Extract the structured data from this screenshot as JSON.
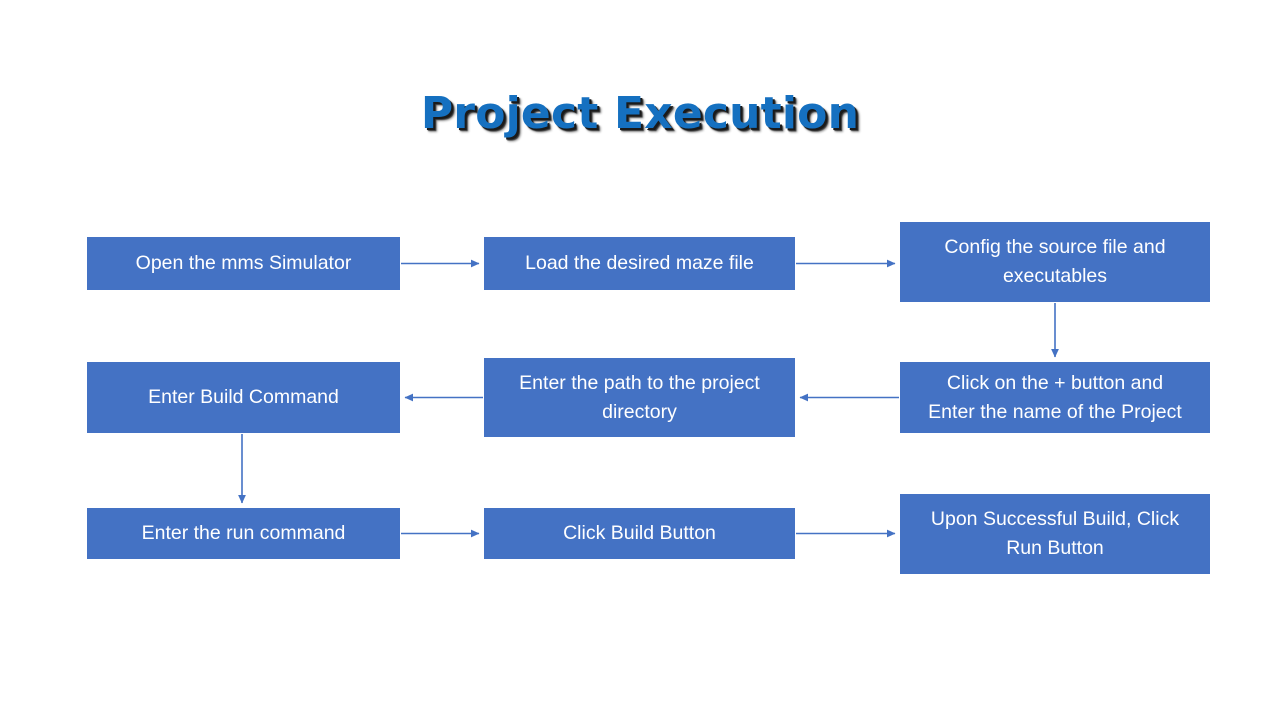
{
  "title": "Project Execution",
  "colors": {
    "box_fill": "#4472C4",
    "box_text": "#FFFFFF",
    "title_text": "#1570C0",
    "title_shadow": "#1A1A1A",
    "connector": "#4472C4",
    "background": "#FFFFFF"
  },
  "flow": {
    "nodes": [
      {
        "id": "n1",
        "label": "Open the mms Simulator",
        "row": 1,
        "col": 1
      },
      {
        "id": "n2",
        "label": "Load the desired maze file",
        "row": 1,
        "col": 2
      },
      {
        "id": "n3",
        "label": "Config the source file and\nexecutables",
        "row": 1,
        "col": 3
      },
      {
        "id": "n4",
        "label": "Click on the + button and\nEnter the name of the Project",
        "row": 2,
        "col": 3
      },
      {
        "id": "n5",
        "label": "Enter the path to the project\ndirectory",
        "row": 2,
        "col": 2
      },
      {
        "id": "n6",
        "label": "Enter Build Command",
        "row": 2,
        "col": 1
      },
      {
        "id": "n7",
        "label": "Enter the run command",
        "row": 3,
        "col": 1
      },
      {
        "id": "n8",
        "label": "Click Build Button",
        "row": 3,
        "col": 2
      },
      {
        "id": "n9",
        "label": "Upon Successful Build, Click\nRun Button",
        "row": 3,
        "col": 3
      }
    ],
    "edges": [
      {
        "from": "n1",
        "to": "n2",
        "direction": "right"
      },
      {
        "from": "n2",
        "to": "n3",
        "direction": "right"
      },
      {
        "from": "n3",
        "to": "n4",
        "direction": "down"
      },
      {
        "from": "n4",
        "to": "n5",
        "direction": "left"
      },
      {
        "from": "n5",
        "to": "n6",
        "direction": "left"
      },
      {
        "from": "n6",
        "to": "n7",
        "direction": "down"
      },
      {
        "from": "n7",
        "to": "n8",
        "direction": "right"
      },
      {
        "from": "n8",
        "to": "n9",
        "direction": "right"
      }
    ]
  }
}
